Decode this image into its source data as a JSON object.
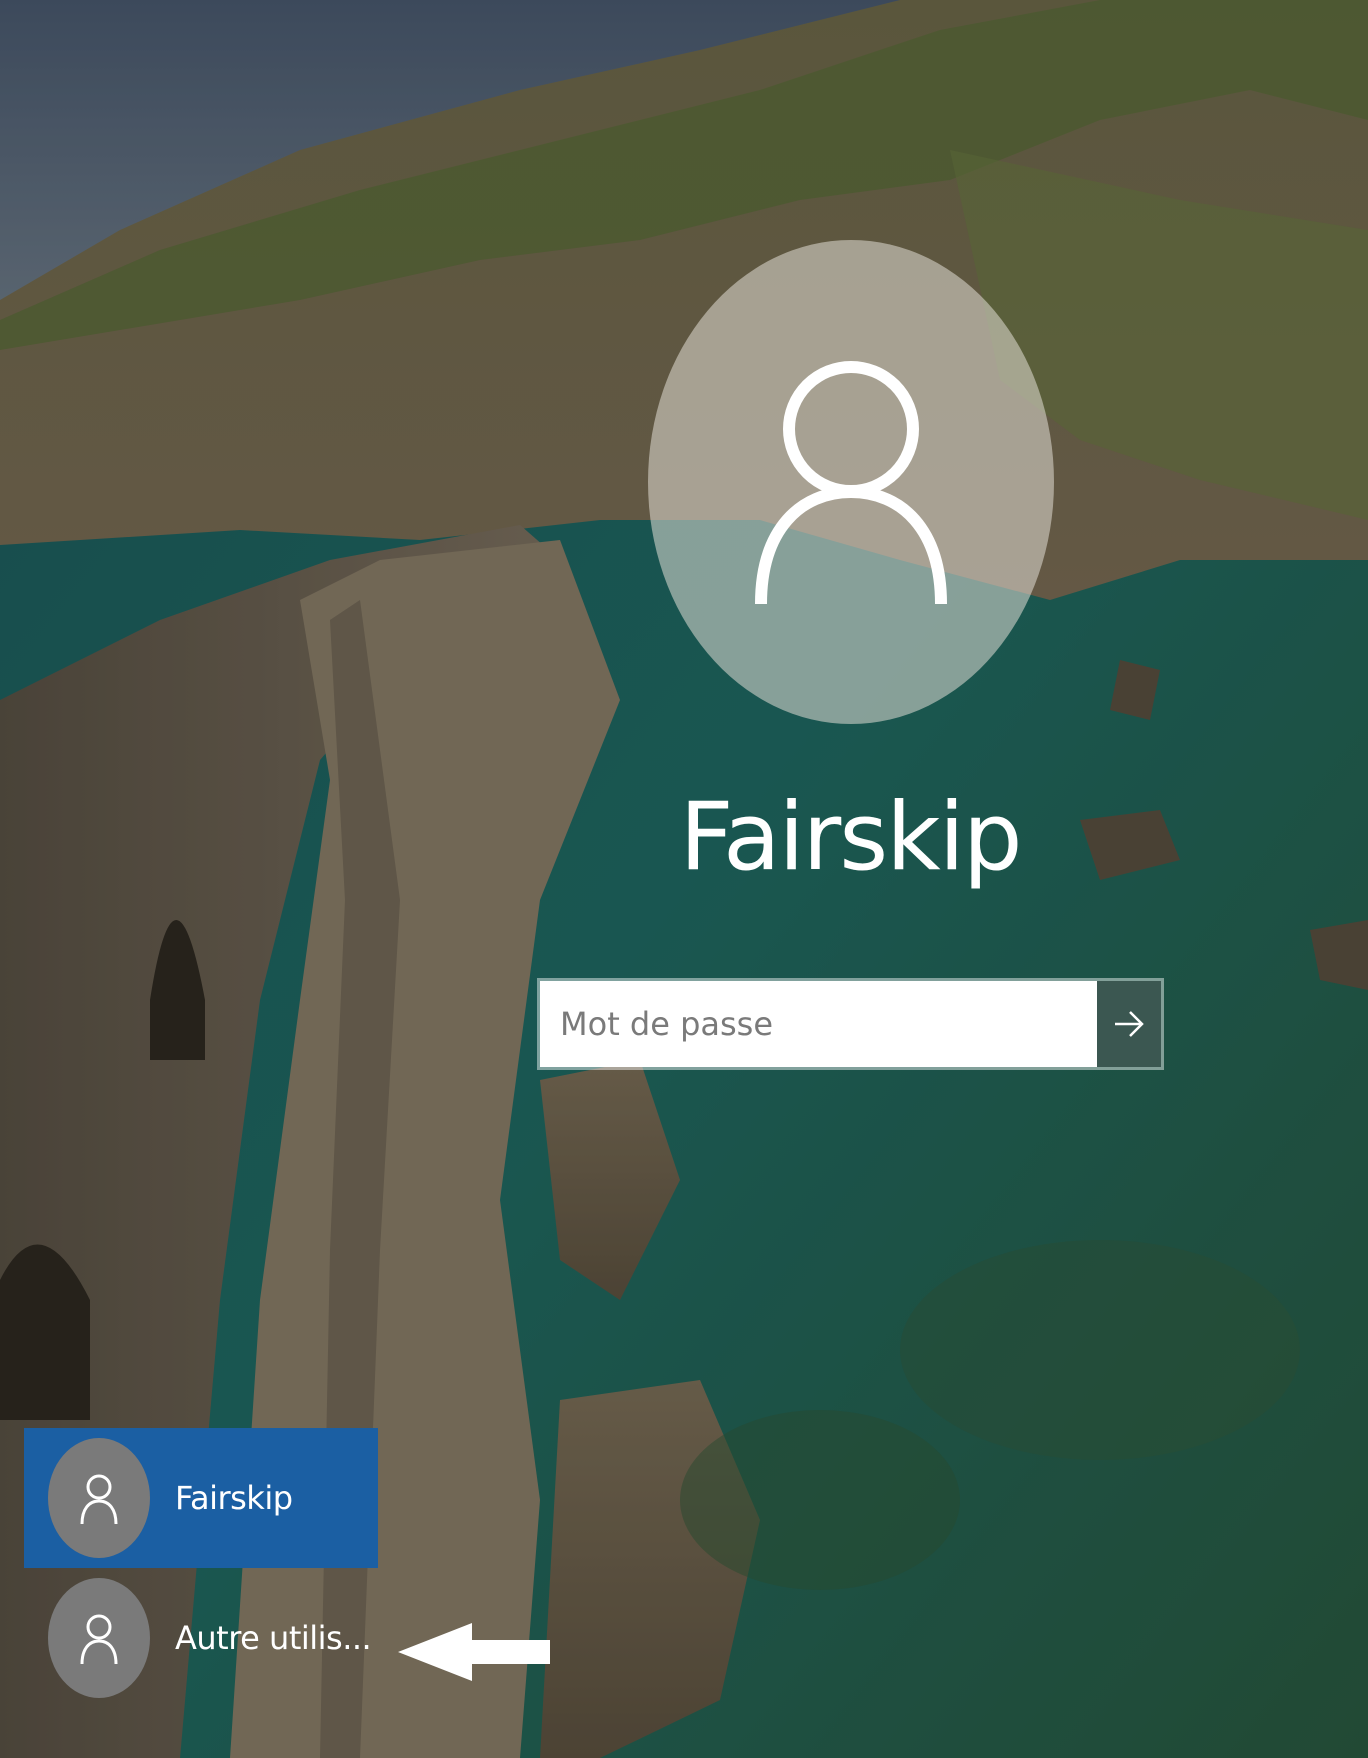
{
  "login": {
    "username": "Fairskip",
    "password_placeholder": "Mot de passe",
    "password_value": ""
  },
  "icons": {
    "avatar": "user-silhouette-icon",
    "submit": "arrow-right-icon",
    "annotation": "arrow-left-icon"
  },
  "users": [
    {
      "label": "Fairskip",
      "selected": true
    },
    {
      "label": "Autre utilis...",
      "selected": false
    }
  ],
  "colors": {
    "selected_user_bg": "#1b5fa3",
    "avatar_bg": "#7a7a7a",
    "text": "#ffffff"
  }
}
